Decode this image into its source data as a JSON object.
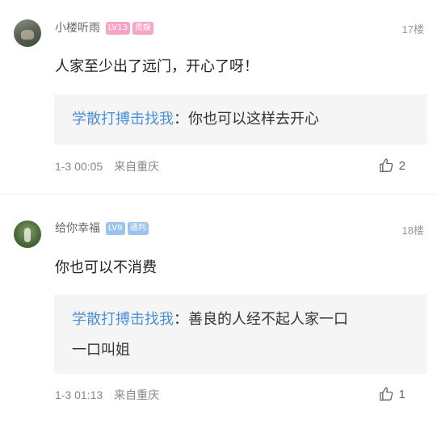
{
  "comments": [
    {
      "username": "小楼听雨",
      "badges": [
        "LV13",
        "责娱"
      ],
      "floor": "17楼",
      "text": "人家至少出了远门，开心了呀！",
      "quote": {
        "author": "学散打搏击找我",
        "sep": "：",
        "text": "你也可以这样去开心"
      },
      "time": "1-3 00:05",
      "location": "来自重庆",
      "likes": "2"
    },
    {
      "username": "给你幸福",
      "badges": [
        "LV9",
        "通判"
      ],
      "floor": "18楼",
      "text": "你也可以不消费",
      "quote": {
        "author": "学散打搏击找我",
        "sep": "：",
        "text_line1": "善良的人经不起人家一口",
        "text_line2": "一口叫姐"
      },
      "time": "1-3 01:13",
      "location": "来自重庆",
      "likes": "1"
    }
  ]
}
